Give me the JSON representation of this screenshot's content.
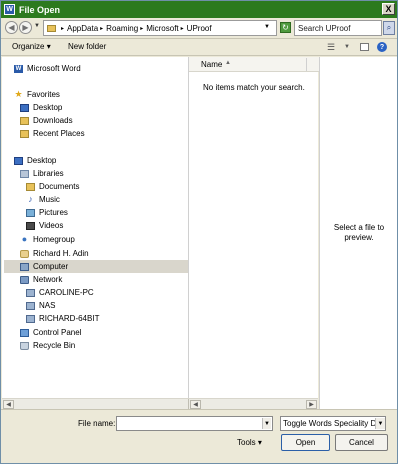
{
  "window": {
    "title": "File Open",
    "app_icon_letter": "W",
    "close_label": "X"
  },
  "address": {
    "back_glyph": "◀",
    "forward_glyph": "▶",
    "breadcrumbs": [
      "AppData",
      "Roaming",
      "Microsoft",
      "UProof"
    ],
    "search_value": "Search UProof"
  },
  "toolbar": {
    "organize_label": "Organize",
    "new_folder_label": "New folder"
  },
  "nav": {
    "items": [
      {
        "label": "Microsoft Word",
        "icon": "word-icon"
      },
      {
        "label": "Favorites",
        "icon": "star-icon"
      },
      {
        "label": "Desktop",
        "icon": "desktop-icon"
      },
      {
        "label": "Downloads",
        "icon": "folder-icon"
      },
      {
        "label": "Recent Places",
        "icon": "folder-icon"
      },
      {
        "label": "Desktop",
        "icon": "desktop-icon"
      },
      {
        "label": "Libraries",
        "icon": "library-icon"
      },
      {
        "label": "Documents",
        "icon": "folder-icon"
      },
      {
        "label": "Music",
        "icon": "music-icon"
      },
      {
        "label": "Pictures",
        "icon": "pictures-icon"
      },
      {
        "label": "Videos",
        "icon": "videos-icon"
      },
      {
        "label": "Homegroup",
        "icon": "homegroup-icon"
      },
      {
        "label": "Richard H. Adin",
        "icon": "user-icon"
      },
      {
        "label": "Computer",
        "icon": "computer-icon"
      },
      {
        "label": "Network",
        "icon": "network-icon"
      },
      {
        "label": "CAROLINE-PC",
        "icon": "pc-icon"
      },
      {
        "label": "NAS",
        "icon": "pc-icon"
      },
      {
        "label": "RICHARD-64BIT",
        "icon": "pc-icon"
      },
      {
        "label": "Control Panel",
        "icon": "control-panel-icon"
      },
      {
        "label": "Recycle Bin",
        "icon": "recycle-bin-icon"
      }
    ],
    "selected": "Computer"
  },
  "list": {
    "column_name": "Name",
    "empty_message": "No items match your search."
  },
  "preview": {
    "message_line1": "Select a file to",
    "message_line2": "preview."
  },
  "bottom": {
    "file_name_label": "File name:",
    "file_name_value": "",
    "filter_value": "Toggle Words Speciality Da",
    "tools_label": "Tools",
    "open_label": "Open",
    "cancel_label": "Cancel"
  }
}
